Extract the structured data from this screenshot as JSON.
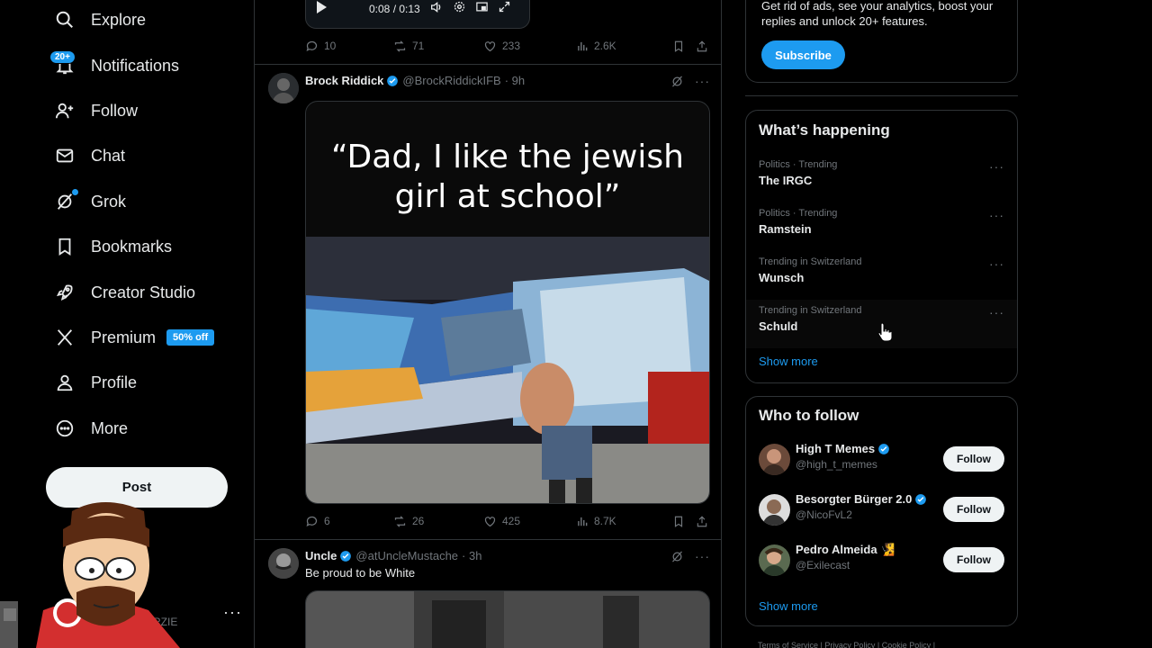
{
  "nav": {
    "items": [
      {
        "label": "Explore",
        "icon": "search-icon"
      },
      {
        "label": "Notifications",
        "icon": "bell-icon"
      },
      {
        "label": "Follow",
        "icon": "person-add-icon"
      },
      {
        "label": "Chat",
        "icon": "mail-icon"
      },
      {
        "label": "Grok",
        "icon": "grok-icon"
      },
      {
        "label": "Bookmarks",
        "icon": "bookmark-icon"
      },
      {
        "label": "Creator Studio",
        "icon": "rocket-icon"
      },
      {
        "label": "Premium",
        "icon": "x-logo-icon"
      },
      {
        "label": "Profile",
        "icon": "person-icon"
      },
      {
        "label": "More",
        "icon": "more-circle-icon"
      }
    ],
    "notifications_badge": "20+",
    "premium_badge": "50% off",
    "post_label": "Post",
    "account_handle_partial": "RZIE",
    "account_more": "···"
  },
  "player": {
    "time": "0:08 / 0:13"
  },
  "tweets": [
    {
      "replies": "10",
      "reposts": "71",
      "likes": "233",
      "views": "2.6K"
    },
    {
      "name": "Brock Riddick",
      "handle": "@BrockRiddickIFB",
      "age": "· 9h",
      "media_caption": "“Dad, I like the jewish girl at school”",
      "replies": "6",
      "reposts": "26",
      "likes": "425",
      "views": "8.7K"
    },
    {
      "name": "Uncle",
      "handle": "@atUncleMustache",
      "age": "· 3h",
      "text": "Be proud to be White"
    }
  ],
  "premium_card": {
    "text": "Get rid of ads, see your analytics, boost your replies and unlock 20+ features.",
    "subscribe_label": "Subscribe"
  },
  "happening": {
    "title": "What’s happening",
    "trends": [
      {
        "meta": "Politics · Trending",
        "name": "The IRGC"
      },
      {
        "meta": "Politics · Trending",
        "name": "Ramstein"
      },
      {
        "meta": "Trending in Switzerland",
        "name": "Wunsch"
      },
      {
        "meta": "Trending in Switzerland",
        "name": "Schuld"
      }
    ],
    "show_more": "Show more"
  },
  "who_to_follow": {
    "title": "Who to follow",
    "accounts": [
      {
        "name": "High T Memes",
        "handle": "@high_t_memes",
        "verified": true
      },
      {
        "name": "Besorgter Bürger 2.0",
        "handle": "@NicoFvL2",
        "verified": true
      },
      {
        "name": "Pedro Almeida 🧏",
        "handle": "@Exilecast",
        "verified": false
      }
    ],
    "follow_label": "Follow",
    "show_more": "Show more"
  },
  "footer": {
    "links": "Terms of Service  |  Privacy Policy  |  Cookie Policy  |"
  },
  "colors": {
    "accent": "#1d9bf0",
    "background": "#000000",
    "border": "#2f3336",
    "muted": "#71767b"
  }
}
